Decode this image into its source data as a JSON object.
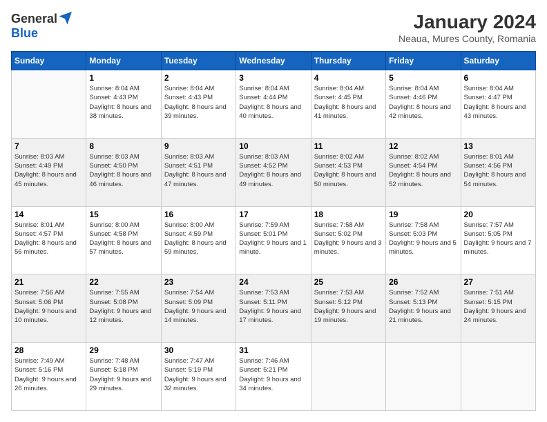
{
  "logo": {
    "general": "General",
    "blue": "Blue"
  },
  "header": {
    "title": "January 2024",
    "subtitle": "Neaua, Mures County, Romania"
  },
  "weekdays": [
    "Sunday",
    "Monday",
    "Tuesday",
    "Wednesday",
    "Thursday",
    "Friday",
    "Saturday"
  ],
  "weeks": [
    [
      {
        "day": "",
        "sunrise": "",
        "sunset": "",
        "daylight": ""
      },
      {
        "day": "1",
        "sunrise": "Sunrise: 8:04 AM",
        "sunset": "Sunset: 4:43 PM",
        "daylight": "Daylight: 8 hours and 38 minutes."
      },
      {
        "day": "2",
        "sunrise": "Sunrise: 8:04 AM",
        "sunset": "Sunset: 4:43 PM",
        "daylight": "Daylight: 8 hours and 39 minutes."
      },
      {
        "day": "3",
        "sunrise": "Sunrise: 8:04 AM",
        "sunset": "Sunset: 4:44 PM",
        "daylight": "Daylight: 8 hours and 40 minutes."
      },
      {
        "day": "4",
        "sunrise": "Sunrise: 8:04 AM",
        "sunset": "Sunset: 4:45 PM",
        "daylight": "Daylight: 8 hours and 41 minutes."
      },
      {
        "day": "5",
        "sunrise": "Sunrise: 8:04 AM",
        "sunset": "Sunset: 4:46 PM",
        "daylight": "Daylight: 8 hours and 42 minutes."
      },
      {
        "day": "6",
        "sunrise": "Sunrise: 8:04 AM",
        "sunset": "Sunset: 4:47 PM",
        "daylight": "Daylight: 8 hours and 43 minutes."
      }
    ],
    [
      {
        "day": "7",
        "sunrise": "Sunrise: 8:03 AM",
        "sunset": "Sunset: 4:49 PM",
        "daylight": "Daylight: 8 hours and 45 minutes."
      },
      {
        "day": "8",
        "sunrise": "Sunrise: 8:03 AM",
        "sunset": "Sunset: 4:50 PM",
        "daylight": "Daylight: 8 hours and 46 minutes."
      },
      {
        "day": "9",
        "sunrise": "Sunrise: 8:03 AM",
        "sunset": "Sunset: 4:51 PM",
        "daylight": "Daylight: 8 hours and 47 minutes."
      },
      {
        "day": "10",
        "sunrise": "Sunrise: 8:03 AM",
        "sunset": "Sunset: 4:52 PM",
        "daylight": "Daylight: 8 hours and 49 minutes."
      },
      {
        "day": "11",
        "sunrise": "Sunrise: 8:02 AM",
        "sunset": "Sunset: 4:53 PM",
        "daylight": "Daylight: 8 hours and 50 minutes."
      },
      {
        "day": "12",
        "sunrise": "Sunrise: 8:02 AM",
        "sunset": "Sunset: 4:54 PM",
        "daylight": "Daylight: 8 hours and 52 minutes."
      },
      {
        "day": "13",
        "sunrise": "Sunrise: 8:01 AM",
        "sunset": "Sunset: 4:56 PM",
        "daylight": "Daylight: 8 hours and 54 minutes."
      }
    ],
    [
      {
        "day": "14",
        "sunrise": "Sunrise: 8:01 AM",
        "sunset": "Sunset: 4:57 PM",
        "daylight": "Daylight: 8 hours and 56 minutes."
      },
      {
        "day": "15",
        "sunrise": "Sunrise: 8:00 AM",
        "sunset": "Sunset: 4:58 PM",
        "daylight": "Daylight: 8 hours and 57 minutes."
      },
      {
        "day": "16",
        "sunrise": "Sunrise: 8:00 AM",
        "sunset": "Sunset: 4:59 PM",
        "daylight": "Daylight: 8 hours and 59 minutes."
      },
      {
        "day": "17",
        "sunrise": "Sunrise: 7:59 AM",
        "sunset": "Sunset: 5:01 PM",
        "daylight": "Daylight: 9 hours and 1 minute."
      },
      {
        "day": "18",
        "sunrise": "Sunrise: 7:58 AM",
        "sunset": "Sunset: 5:02 PM",
        "daylight": "Daylight: 9 hours and 3 minutes."
      },
      {
        "day": "19",
        "sunrise": "Sunrise: 7:58 AM",
        "sunset": "Sunset: 5:03 PM",
        "daylight": "Daylight: 9 hours and 5 minutes."
      },
      {
        "day": "20",
        "sunrise": "Sunrise: 7:57 AM",
        "sunset": "Sunset: 5:05 PM",
        "daylight": "Daylight: 9 hours and 7 minutes."
      }
    ],
    [
      {
        "day": "21",
        "sunrise": "Sunrise: 7:56 AM",
        "sunset": "Sunset: 5:06 PM",
        "daylight": "Daylight: 9 hours and 10 minutes."
      },
      {
        "day": "22",
        "sunrise": "Sunrise: 7:55 AM",
        "sunset": "Sunset: 5:08 PM",
        "daylight": "Daylight: 9 hours and 12 minutes."
      },
      {
        "day": "23",
        "sunrise": "Sunrise: 7:54 AM",
        "sunset": "Sunset: 5:09 PM",
        "daylight": "Daylight: 9 hours and 14 minutes."
      },
      {
        "day": "24",
        "sunrise": "Sunrise: 7:53 AM",
        "sunset": "Sunset: 5:11 PM",
        "daylight": "Daylight: 9 hours and 17 minutes."
      },
      {
        "day": "25",
        "sunrise": "Sunrise: 7:53 AM",
        "sunset": "Sunset: 5:12 PM",
        "daylight": "Daylight: 9 hours and 19 minutes."
      },
      {
        "day": "26",
        "sunrise": "Sunrise: 7:52 AM",
        "sunset": "Sunset: 5:13 PM",
        "daylight": "Daylight: 9 hours and 21 minutes."
      },
      {
        "day": "27",
        "sunrise": "Sunrise: 7:51 AM",
        "sunset": "Sunset: 5:15 PM",
        "daylight": "Daylight: 9 hours and 24 minutes."
      }
    ],
    [
      {
        "day": "28",
        "sunrise": "Sunrise: 7:49 AM",
        "sunset": "Sunset: 5:16 PM",
        "daylight": "Daylight: 9 hours and 26 minutes."
      },
      {
        "day": "29",
        "sunrise": "Sunrise: 7:48 AM",
        "sunset": "Sunset: 5:18 PM",
        "daylight": "Daylight: 9 hours and 29 minutes."
      },
      {
        "day": "30",
        "sunrise": "Sunrise: 7:47 AM",
        "sunset": "Sunset: 5:19 PM",
        "daylight": "Daylight: 9 hours and 32 minutes."
      },
      {
        "day": "31",
        "sunrise": "Sunrise: 7:46 AM",
        "sunset": "Sunset: 5:21 PM",
        "daylight": "Daylight: 9 hours and 34 minutes."
      },
      {
        "day": "",
        "sunrise": "",
        "sunset": "",
        "daylight": ""
      },
      {
        "day": "",
        "sunrise": "",
        "sunset": "",
        "daylight": ""
      },
      {
        "day": "",
        "sunrise": "",
        "sunset": "",
        "daylight": ""
      }
    ]
  ]
}
